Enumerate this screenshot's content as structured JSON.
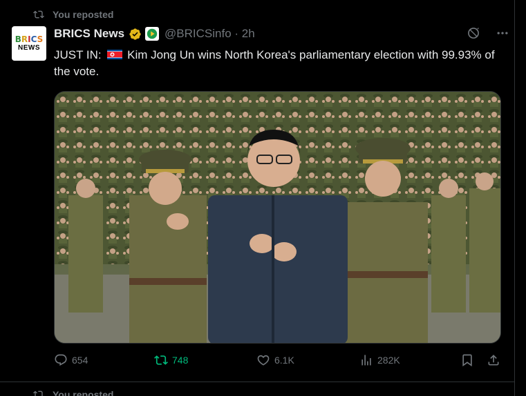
{
  "repost_header": {
    "label": "You reposted",
    "icon": "repost-icon"
  },
  "tweet": {
    "author_name": "BRICS News",
    "avatar": {
      "line1": "BRICS",
      "line2": "NEWS"
    },
    "handle": "@BRICSinfo",
    "separator": "·",
    "time": "2h",
    "text_prefix": "JUST IN:",
    "text_body": "Kim Jong Un wins North Korea's parliamentary election with 99.93% of the vote.",
    "flag": "north-korea-flag",
    "media_description_icon": "photo"
  },
  "metrics": {
    "replies": "654",
    "reposts": "748",
    "likes": "6.1K",
    "views": "282K"
  },
  "next_repost_header": {
    "label": "You reposted"
  },
  "colors": {
    "background": "#000000",
    "text": "#e7e9ea",
    "muted": "#71767b",
    "repost_active": "#00ba7c",
    "verified_gold": "#e2b719"
  }
}
